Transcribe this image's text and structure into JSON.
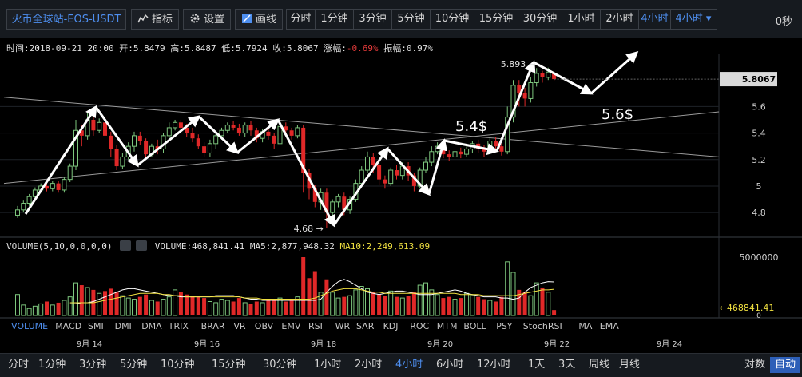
{
  "toolbar": {
    "symbol": "火币全球站-EOS-USDT",
    "indicators_label": "指标",
    "settings_label": "设置",
    "draw_label": "画线",
    "timeframes": [
      "分时",
      "1分钟",
      "3分钟",
      "5分钟",
      "10分钟",
      "15分钟",
      "30分钟",
      "1小时",
      "2小时",
      "4小时"
    ],
    "active_timeframe": "4小时",
    "dropdown_label": "4小时",
    "countdown": "0秒"
  },
  "info": {
    "time_label": "时间:",
    "time": "2018-09-21 20:00",
    "open_label": "开:",
    "open": "5.8479",
    "high_label": "高:",
    "high": "5.8487",
    "low_label": "低:",
    "low": "5.7924",
    "close_label": "收:",
    "close": "5.8067",
    "change_label": "涨幅:",
    "change": "-0.69%",
    "amplitude_label": "振幅:",
    "amplitude": "0.97%"
  },
  "volume_info": {
    "params": "VOLUME(5,10,0,0,0,0)",
    "volume": "VOLUME:468,841.41",
    "ma5": "MA5:2,877,948.32",
    "ma10": "MA10:2,249,613.09",
    "axis_top": "5000000",
    "current": "←468841.41",
    "axis_zero": "0"
  },
  "indicator_tabs": [
    "VOLUME",
    "MACD",
    "SMI",
    "DMI",
    "DMA",
    "TRIX",
    "BRAR",
    "VR",
    "OBV",
    "EMV",
    "RSI",
    "WR",
    "SAR",
    "KDJ",
    "ROC",
    "MTM",
    "BOLL",
    "PSY",
    "StochRSI",
    "MA",
    "EMA"
  ],
  "active_indicator": "VOLUME",
  "bottom_timeframes": [
    "分时",
    "1分钟",
    "3分钟",
    "5分钟",
    "10分钟",
    "15分钟",
    "30分钟",
    "1小时",
    "2小时",
    "4小时",
    "6小时",
    "12小时",
    "1天",
    "3天",
    "周线",
    "月线"
  ],
  "bottom_active": "4小时",
  "bottom_right": {
    "log": "对数",
    "auto": "自动"
  },
  "colors": {
    "up": "#7dc67d",
    "down": "#e02828",
    "accent": "#4e8ff0",
    "ma10": "#f0e040",
    "ma5": "#ffffff"
  },
  "chart_data": {
    "type": "candlestick",
    "x_tick_labels": [
      "9月 14",
      "9月 16",
      "9月 18",
      "9月 20",
      "9月 22",
      "9月 24"
    ],
    "y_ticks": [
      4.8,
      5,
      5.2,
      5.4,
      5.6
    ],
    "y_tick_labels": [
      "4.8",
      "5",
      "5.2",
      "5.4",
      "5.6"
    ],
    "ylim": [
      4.62,
      6.0
    ],
    "last_price_label": "5.8067",
    "last_price": 5.8067,
    "high_marker_label": "5.893 →",
    "high_marker": 5.893,
    "low_marker_label": "4.68 →",
    "low_marker": 4.68,
    "annotation_1": "5.4$",
    "annotation_2": "5.6$",
    "candles": [
      [
        4.78,
        4.82,
        4.85,
        4.76
      ],
      [
        4.82,
        4.87,
        4.89,
        4.8
      ],
      [
        4.87,
        4.92,
        4.94,
        4.85
      ],
      [
        4.92,
        4.97,
        4.99,
        4.9
      ],
      [
        4.97,
        5.0,
        5.02,
        4.95
      ],
      [
        5.0,
        4.98,
        5.03,
        4.96
      ],
      [
        4.98,
        5.02,
        5.04,
        4.96
      ],
      [
        5.02,
        4.97,
        5.04,
        4.95
      ],
      [
        4.97,
        5.05,
        5.07,
        4.95
      ],
      [
        5.05,
        5.15,
        5.17,
        5.03
      ],
      [
        5.15,
        5.42,
        5.5,
        5.12
      ],
      [
        5.42,
        5.38,
        5.46,
        5.3
      ],
      [
        5.38,
        5.5,
        5.55,
        5.35
      ],
      [
        5.5,
        5.42,
        5.52,
        5.38
      ],
      [
        5.42,
        5.48,
        5.51,
        5.4
      ],
      [
        5.48,
        5.38,
        5.5,
        5.33
      ],
      [
        5.38,
        5.28,
        5.41,
        5.22
      ],
      [
        5.28,
        5.15,
        5.31,
        5.12
      ],
      [
        5.15,
        5.22,
        5.25,
        5.13
      ],
      [
        5.22,
        5.3,
        5.33,
        5.2
      ],
      [
        5.3,
        5.38,
        5.41,
        5.26
      ],
      [
        5.38,
        5.34,
        5.41,
        5.31
      ],
      [
        5.34,
        5.24,
        5.36,
        5.21
      ],
      [
        5.24,
        5.3,
        5.32,
        5.22
      ],
      [
        5.3,
        5.28,
        5.35,
        5.24
      ],
      [
        5.28,
        5.38,
        5.4,
        5.25
      ],
      [
        5.38,
        5.44,
        5.48,
        5.36
      ],
      [
        5.44,
        5.48,
        5.5,
        5.42
      ],
      [
        5.48,
        5.44,
        5.5,
        5.4
      ],
      [
        5.44,
        5.4,
        5.47,
        5.37
      ],
      [
        5.4,
        5.36,
        5.44,
        5.33
      ],
      [
        5.36,
        5.3,
        5.39,
        5.28
      ],
      [
        5.3,
        5.25,
        5.33,
        5.22
      ],
      [
        5.25,
        5.32,
        5.35,
        5.22
      ],
      [
        5.32,
        5.38,
        5.41,
        5.28
      ],
      [
        5.38,
        5.42,
        5.44,
        5.35
      ],
      [
        5.42,
        5.46,
        5.48,
        5.4
      ],
      [
        5.46,
        5.44,
        5.49,
        5.42
      ],
      [
        5.44,
        5.4,
        5.47,
        5.38
      ],
      [
        5.4,
        5.46,
        5.48,
        5.37
      ],
      [
        5.46,
        5.42,
        5.49,
        5.38
      ],
      [
        5.42,
        5.36,
        5.44,
        5.33
      ],
      [
        5.36,
        5.41,
        5.43,
        5.33
      ],
      [
        5.41,
        5.38,
        5.45,
        5.35
      ],
      [
        5.38,
        5.32,
        5.4,
        5.28
      ],
      [
        5.32,
        5.45,
        5.47,
        5.28
      ],
      [
        5.45,
        5.42,
        5.48,
        5.38
      ],
      [
        5.42,
        5.38,
        5.44,
        5.35
      ],
      [
        5.38,
        5.44,
        5.46,
        5.36
      ],
      [
        5.44,
        5.1,
        5.46,
        4.95
      ],
      [
        5.1,
        4.98,
        5.13,
        4.9
      ],
      [
        4.98,
        4.88,
        5.01,
        4.84
      ],
      [
        4.88,
        4.95,
        4.98,
        4.82
      ],
      [
        4.95,
        4.8,
        4.98,
        4.68
      ],
      [
        4.8,
        4.88,
        4.9,
        4.77
      ],
      [
        4.88,
        4.92,
        4.94,
        4.84
      ],
      [
        4.92,
        4.82,
        4.95,
        4.78
      ],
      [
        4.82,
        4.9,
        4.92,
        4.79
      ],
      [
        4.9,
        5.02,
        5.05,
        4.88
      ],
      [
        5.02,
        5.12,
        5.15,
        5.0
      ],
      [
        5.12,
        5.22,
        5.26,
        5.1
      ],
      [
        5.22,
        5.16,
        5.25,
        5.1
      ],
      [
        5.16,
        5.05,
        5.18,
        5.01
      ],
      [
        5.05,
        5.02,
        5.08,
        4.98
      ],
      [
        5.02,
        5.12,
        5.14,
        5.0
      ],
      [
        5.12,
        5.08,
        5.16,
        5.05
      ],
      [
        5.08,
        5.15,
        5.18,
        5.05
      ],
      [
        5.15,
        5.08,
        5.18,
        5.04
      ],
      [
        5.08,
        5.0,
        5.1,
        4.96
      ],
      [
        5.0,
        5.12,
        5.14,
        4.98
      ],
      [
        5.12,
        5.18,
        5.22,
        5.1
      ],
      [
        5.18,
        5.26,
        5.3,
        5.15
      ],
      [
        5.26,
        5.3,
        5.33,
        5.24
      ],
      [
        5.3,
        5.24,
        5.32,
        5.21
      ],
      [
        5.24,
        5.22,
        5.27,
        5.19
      ],
      [
        5.22,
        5.26,
        5.28,
        5.2
      ],
      [
        5.26,
        5.24,
        5.29,
        5.21
      ],
      [
        5.24,
        5.28,
        5.3,
        5.22
      ],
      [
        5.28,
        5.32,
        5.34,
        5.25
      ],
      [
        5.32,
        5.28,
        5.35,
        5.25
      ],
      [
        5.28,
        5.26,
        5.31,
        5.22
      ],
      [
        5.26,
        5.34,
        5.36,
        5.24
      ],
      [
        5.34,
        5.3,
        5.37,
        5.27
      ],
      [
        5.3,
        5.26,
        5.32,
        5.23
      ],
      [
        5.26,
        5.52,
        5.6,
        5.24
      ],
      [
        5.52,
        5.76,
        5.8,
        5.48
      ],
      [
        5.76,
        5.7,
        5.8,
        5.6
      ],
      [
        5.7,
        5.66,
        5.74,
        5.6
      ],
      [
        5.66,
        5.78,
        5.82,
        5.63
      ],
      [
        5.78,
        5.85,
        5.89,
        5.75
      ],
      [
        5.85,
        5.82,
        5.87,
        5.78
      ],
      [
        5.82,
        5.86,
        5.893,
        5.8
      ],
      [
        5.8479,
        5.8067,
        5.8487,
        5.7924
      ]
    ],
    "volume": [
      1800000,
      900000,
      600000,
      800000,
      1000000,
      1200000,
      900000,
      1100000,
      1300000,
      1600000,
      2800000,
      2600000,
      2400000,
      2200000,
      1900000,
      2100000,
      2300000,
      2000000,
      1700000,
      1500000,
      1400000,
      1600000,
      1800000,
      1300000,
      1200000,
      1400000,
      1600000,
      2200000,
      2000000,
      1800000,
      1700000,
      1600000,
      1500000,
      1200000,
      1100000,
      1400000,
      1300000,
      1200000,
      1500000,
      1100000,
      1000000,
      1200000,
      1100000,
      1300000,
      1400000,
      1500000,
      1200000,
      1300000,
      1600000,
      5000000,
      3200000,
      3800000,
      2000000,
      3100000,
      2000000,
      1500000,
      1600000,
      1700000,
      2200000,
      2500000,
      2300000,
      2000000,
      1800000,
      1700000,
      2100000,
      1600000,
      1500000,
      1700000,
      2000000,
      2600000,
      2800000,
      2200000,
      1800000,
      1500000,
      1600000,
      1400000,
      1500000,
      1900000,
      1700000,
      1600000,
      1400000,
      1300000,
      1200000,
      1600000,
      4600000,
      3700000,
      2200000,
      2000000,
      1700000,
      2800000,
      2400000,
      2000000,
      468841
    ],
    "ma5_volume": [
      1000000,
      1000000,
      1100000,
      1100000,
      1200000,
      1400000,
      1600000,
      1800000,
      2000000,
      2200000,
      2300000,
      2300000,
      2200000,
      2100000,
      2000000,
      1900000,
      1800000,
      1700000,
      1700000,
      1600000,
      1600000,
      1600000,
      1600000,
      1600000,
      1600000,
      1700000,
      1700000,
      1700000,
      1700000,
      1600000,
      1500000,
      1400000,
      1400000,
      1300000,
      1300000,
      1300000,
      1300000,
      1300000,
      1300000,
      1300000,
      1300000,
      1300000,
      1300000,
      1400000,
      2000000,
      2500000,
      2900000,
      3100000,
      2900000,
      2600000,
      2300000,
      2000000,
      1900000,
      1800000,
      1900000,
      2000000,
      2100000,
      2100000,
      2000000,
      1900000,
      1800000,
      1800000,
      1800000,
      1900000,
      2000000,
      2100000,
      2200000,
      2100000,
      1900000,
      1800000,
      1700000,
      1600000,
      1600000,
      1600000,
      1500000,
      1500000,
      1400000,
      1500000,
      2000000,
      2400000,
      2600000,
      2800000,
      2900000,
      2877948
    ],
    "ma10_volume": [
      1100000,
      1100000,
      1100000,
      1100000,
      1100000,
      1200000,
      1300000,
      1400000,
      1500000,
      1600000,
      1700000,
      1800000,
      1900000,
      1900000,
      1900000,
      1900000,
      1800000,
      1800000,
      1700000,
      1700000,
      1600000,
      1600000,
      1600000,
      1600000,
      1600000,
      1600000,
      1600000,
      1600000,
      1600000,
      1600000,
      1500000,
      1500000,
      1500000,
      1400000,
      1400000,
      1400000,
      1400000,
      1400000,
      1400000,
      1400000,
      1400000,
      1400000,
      1500000,
      1700000,
      1900000,
      2100000,
      2200000,
      2300000,
      2300000,
      2300000,
      2200000,
      2100000,
      2000000,
      2000000,
      1900000,
      1900000,
      1900000,
      1900000,
      1900000,
      1900000,
      1900000,
      1900000,
      1900000,
      1900000,
      1900000,
      1900000,
      1900000,
      1800000,
      1800000,
      1800000,
      1800000,
      1700000,
      1700000,
      1700000,
      1700000,
      1700000,
      1700000,
      1800000,
      1900000,
      2000000,
      2100000,
      2200000,
      2200000,
      2249613
    ]
  }
}
